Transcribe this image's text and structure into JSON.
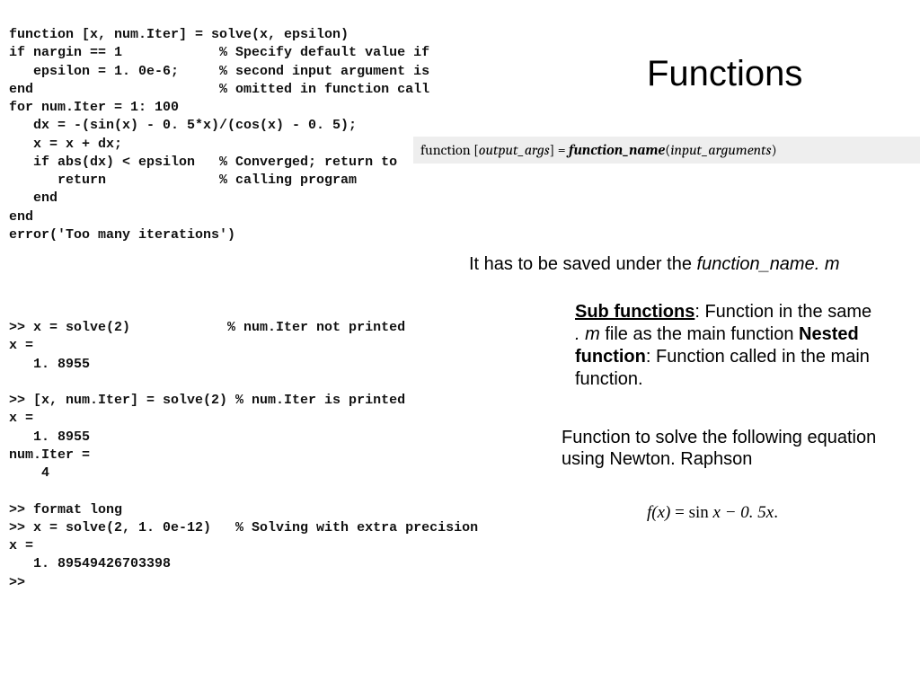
{
  "title": "Functions",
  "code": {
    "func": "function [x, num.Iter] = solve(x, epsilon)\nif nargin == 1            % Specify default value if\n   epsilon = 1. 0e-6;     % second input argument is\nend                       % omitted in function call\nfor num.Iter = 1: 100\n   dx = -(sin(x) - 0. 5*x)/(cos(x) - 0. 5);\n   x = x + dx;\n   if abs(dx) < epsilon   % Converged; return to\n      return              % calling program\n   end\nend\nerror('Too many iterations')",
    "session": ">> x = solve(2)            % num.Iter not printed\nx =\n   1. 8955\n\n>> [x, num.Iter] = solve(2) % num.Iter is printed\nx =\n   1. 8955\nnum.Iter =\n    4\n\n>> format long\n>> x = solve(2, 1. 0e-12)   % Solving with extra precision\nx =\n   1. 89549426703398\n>>"
  },
  "syntax": {
    "kw": "function",
    "lbr": " [",
    "out": "output_args",
    "rbr": "] = ",
    "fn": "function_name",
    "lp": "(",
    "in": "input_arguments",
    "rp": ")"
  },
  "save_note": {
    "pre": "It has to be saved under the ",
    "fname": "function_name. m"
  },
  "sub_note": {
    "p1a": "Sub functions",
    "p1b": ": Function in the same ",
    "p1c": ". m",
    "p1d": " file as the main function ",
    "p2a": "Nested function",
    "p2b": ": Function called in the main function."
  },
  "eq_note": "Function to solve the following equation using Newton. Raphson",
  "equation": {
    "lhs": "f(x)",
    "eq": " = ",
    "rhs1": "sin",
    "rhs2": " x − 0. 5x",
    "dot": "."
  }
}
